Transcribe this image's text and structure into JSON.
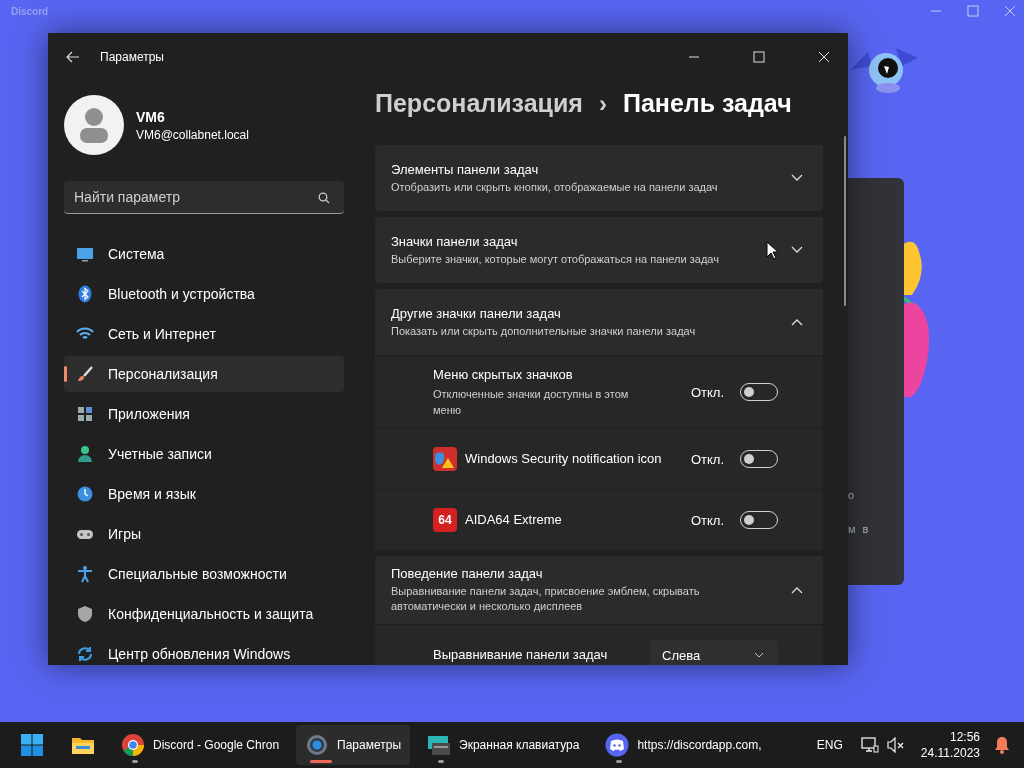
{
  "background_window": {
    "title": "Discord",
    "text_fragments": [
      "о",
      "м в"
    ]
  },
  "settings": {
    "title": "Параметры",
    "user": {
      "name": "VM6",
      "email": "VM6@collabnet.local"
    },
    "search": {
      "placeholder": "Найти параметр"
    },
    "nav": [
      {
        "label": "Система",
        "kind": "system",
        "selected": false
      },
      {
        "label": "Bluetooth и устройства",
        "kind": "bluetooth",
        "selected": false
      },
      {
        "label": "Сеть и Интернет",
        "kind": "network",
        "selected": false
      },
      {
        "label": "Персонализация",
        "kind": "brush",
        "selected": true
      },
      {
        "label": "Приложения",
        "kind": "apps",
        "selected": false
      },
      {
        "label": "Учетные записи",
        "kind": "account",
        "selected": false
      },
      {
        "label": "Время и язык",
        "kind": "time",
        "selected": false
      },
      {
        "label": "Игры",
        "kind": "gaming",
        "selected": false
      },
      {
        "label": "Специальные возможности",
        "kind": "accessibility",
        "selected": false
      },
      {
        "label": "Конфиденциальность и защита",
        "kind": "privacy",
        "selected": false
      },
      {
        "label": "Центр обновления Windows",
        "kind": "update",
        "selected": false
      }
    ],
    "breadcrumb": {
      "parent": "Персонализация",
      "separator": "›",
      "current": "Панель задач"
    },
    "sections": [
      {
        "title": "Элементы панели задач",
        "subtitle": "Отобразить или скрыть кнопки, отображаемые на панели задач",
        "expanded": false
      },
      {
        "title": "Значки панели задач",
        "subtitle": "Выберите значки, которые могут отображаться на панели задач",
        "expanded": false
      },
      {
        "title": "Другие значки панели задач",
        "subtitle": "Показать или скрыть дополнительные значки панели задач",
        "expanded": true,
        "rows": [
          {
            "kind": "toggle",
            "title": "Меню скрытых значков",
            "subtitle": "Отключенные значки доступны в этом меню",
            "state_label": "Откл.",
            "on": false
          },
          {
            "kind": "toggle",
            "icon": {
              "kind": "shield"
            },
            "title": "Windows Security notification icon",
            "state_label": "Откл.",
            "on": false
          },
          {
            "kind": "toggle",
            "icon": {
              "kind": "badge",
              "text": "64"
            },
            "title": "AIDA64 Extreme",
            "state_label": "Откл.",
            "on": false
          }
        ]
      },
      {
        "title": "Поведение панели задач",
        "subtitle": "Выравнивание панели задач, присвоение эмблем, скрывать автоматически и несколько дисплеев",
        "expanded": true,
        "rows": [
          {
            "kind": "dropdown",
            "title": "Выравнивание панели задач",
            "value": "Слева"
          }
        ]
      }
    ]
  },
  "taskbar": {
    "apps": [
      {
        "kind": "explorer",
        "running": false,
        "selected": false
      },
      {
        "kind": "chrome",
        "label": "Discord - Google Chron",
        "running": true,
        "selected": false
      },
      {
        "kind": "settings",
        "label": "Параметры",
        "running": true,
        "selected": true
      },
      {
        "kind": "keyboard",
        "label": "Экранная клавиатура",
        "running": true,
        "selected": false
      },
      {
        "kind": "discord",
        "label": "https://discordapp.com,",
        "running": true,
        "selected": false
      }
    ],
    "language": "ENG",
    "time": "12:56",
    "date": "24.11.2023"
  }
}
